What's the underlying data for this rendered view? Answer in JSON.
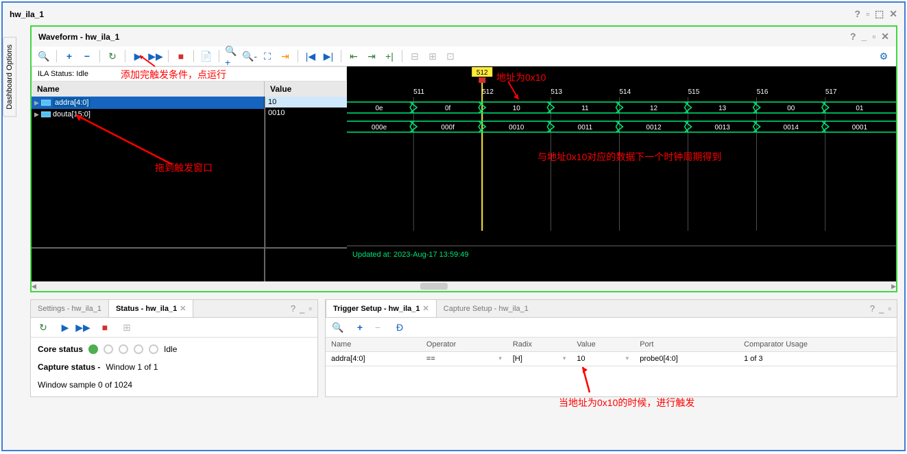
{
  "outer": {
    "title": "hw_ila_1"
  },
  "dashboard_tab": "Dashboard Options",
  "waveform": {
    "title": "Waveform - hw_ila_1",
    "ila_status": "ILA Status: Idle",
    "name_col": "Name",
    "value_col": "Value",
    "signals": [
      {
        "name": "addra[4:0]",
        "value": "10",
        "selected": true
      },
      {
        "name": "douta[15:0]",
        "value": "0010",
        "selected": false
      }
    ],
    "updated_at": "Updated at: 2023-Aug-17 13:59:49",
    "timeline": {
      "trigger_marker": "512",
      "ticks": [
        "511",
        "512",
        "513",
        "514",
        "515",
        "516",
        "517"
      ],
      "addra_values": [
        "0e",
        "0f",
        "10",
        "11",
        "12",
        "13",
        "00",
        "01"
      ],
      "douta_values": [
        "000e",
        "000f",
        "0010",
        "0011",
        "0012",
        "0013",
        "0014",
        "0001"
      ]
    }
  },
  "annotations": {
    "a1": "添加完触发条件，点运行",
    "a2": "拖到触发窗口",
    "a3": "地址为0x10",
    "a4": "与地址0x10对应的数据下一个时钟周期得到",
    "a5": "当地址为0x10的时候，进行触发"
  },
  "status_panel": {
    "tab_settings": "Settings - hw_ila_1",
    "tab_status": "Status - hw_ila_1",
    "core_status_label": "Core status",
    "core_status_value": "Idle",
    "capture_status_label": "Capture status -",
    "capture_status_value": "Window 1 of 1",
    "window_sample": "Window sample 0 of 1024"
  },
  "trigger_panel": {
    "tab_trigger": "Trigger Setup - hw_ila_1",
    "tab_capture": "Capture Setup - hw_ila_1",
    "cols": {
      "name": "Name",
      "operator": "Operator",
      "radix": "Radix",
      "value": "Value",
      "port": "Port",
      "comparator": "Comparator Usage"
    },
    "row": {
      "name": "addra[4:0]",
      "operator": "==",
      "radix": "[H]",
      "value": "10",
      "port": "probe0[4:0]",
      "comparator": "1 of 3"
    }
  }
}
